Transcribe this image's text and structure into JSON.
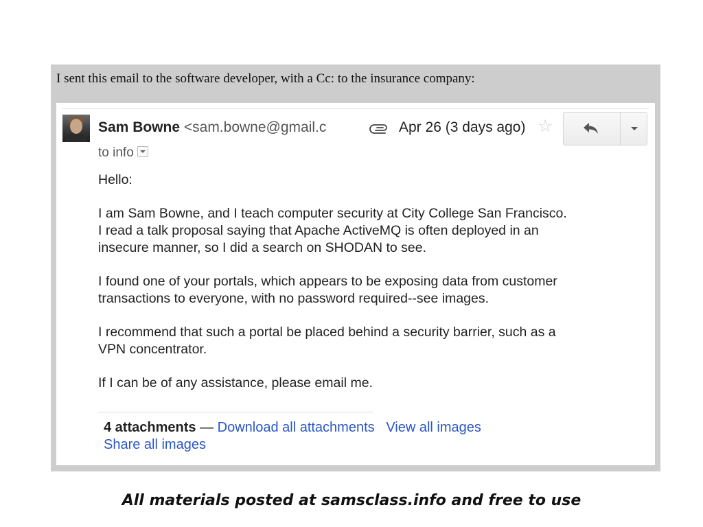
{
  "caption": "I sent this email to the software developer, with a Cc: to the insurance company:",
  "email": {
    "sender_name": "Sam Bowne",
    "sender_addr": "<sam.bowne@gmail.c",
    "date": "Apr 26 (3 days ago)",
    "to_line": "to info",
    "paragraphs": [
      "Hello:",
      "I am Sam Bowne, and I teach computer security at City College San Francisco.\n I read a talk proposal saying that Apache ActiveMQ is often deployed in an\ninsecure manner, so I did a search on SHODAN to see.",
      "I found one of your portals, which appears to be exposing data from customer\ntransactions to everyone, with no password required--see images.",
      "I recommend that such a portal be placed behind a security barrier, such as a\nVPN concentrator.",
      "If I can be of any assistance, please email me."
    ],
    "attachments": {
      "count_label": "4 attachments",
      "dash": " — ",
      "download_all": "Download all attachments",
      "view_all": "View all images",
      "share_all": "Share all images"
    },
    "icons": {
      "attachment": "paperclip-icon",
      "star": "star-icon",
      "reply": "reply-icon",
      "more": "chevron-down-icon"
    }
  },
  "footer": "All materials posted at samsclass.info and free to use"
}
